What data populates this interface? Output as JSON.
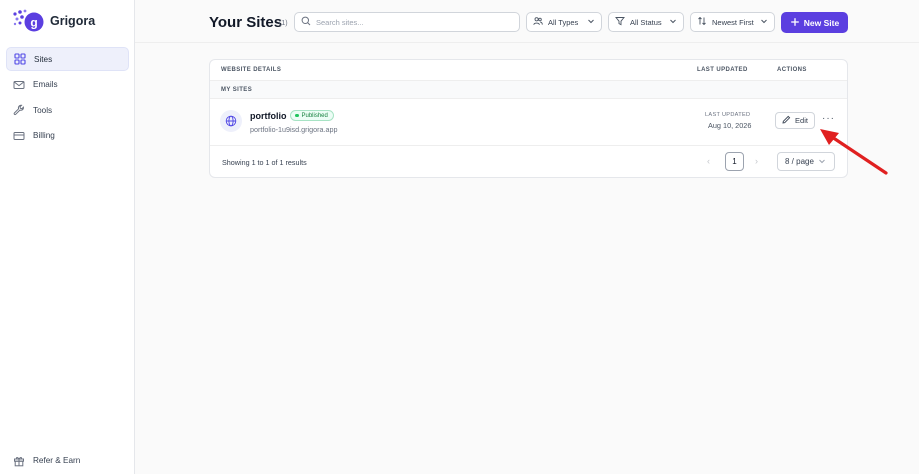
{
  "app": {
    "name": "Grigora"
  },
  "sidebar": {
    "items": [
      {
        "label": "Sites",
        "icon": "grid-icon",
        "active": true
      },
      {
        "label": "Emails",
        "icon": "mail-icon"
      },
      {
        "label": "Tools",
        "icon": "wrench-icon"
      },
      {
        "label": "Billing",
        "icon": "credit-card-icon"
      }
    ],
    "footer": {
      "label": "Refer & Earn",
      "icon": "gift-icon"
    }
  },
  "header": {
    "title": "Your Sites",
    "count": "(1)",
    "search": {
      "placeholder": "Search sites...",
      "value": ""
    },
    "filters": [
      {
        "label": "All Types",
        "icon": "users-icon"
      },
      {
        "label": "All Status",
        "icon": "filter-icon"
      },
      {
        "label": "Newest First",
        "icon": "sort-icon"
      }
    ],
    "new_site_label": "New Site"
  },
  "table": {
    "columns": [
      "WEBSITE DETAILS",
      "LAST UPDATED",
      "ACTIONS"
    ],
    "group_label": "MY SITES",
    "rows": [
      {
        "name": "portfolio",
        "status": "Published",
        "url": "portfolio-1u9isd.grigora.app",
        "last_updated_label": "LAST UPDATED",
        "last_updated": "Aug 10, 2026",
        "edit_label": "Edit",
        "more_label": "···"
      }
    ],
    "footer": {
      "showing": "Showing 1 to 1 of 1 results",
      "page": "1",
      "page_size": "8 / page"
    }
  },
  "colors": {
    "accent": "#5b3fe0",
    "published": "#22c55e",
    "annotation_arrow": "#e02020"
  }
}
